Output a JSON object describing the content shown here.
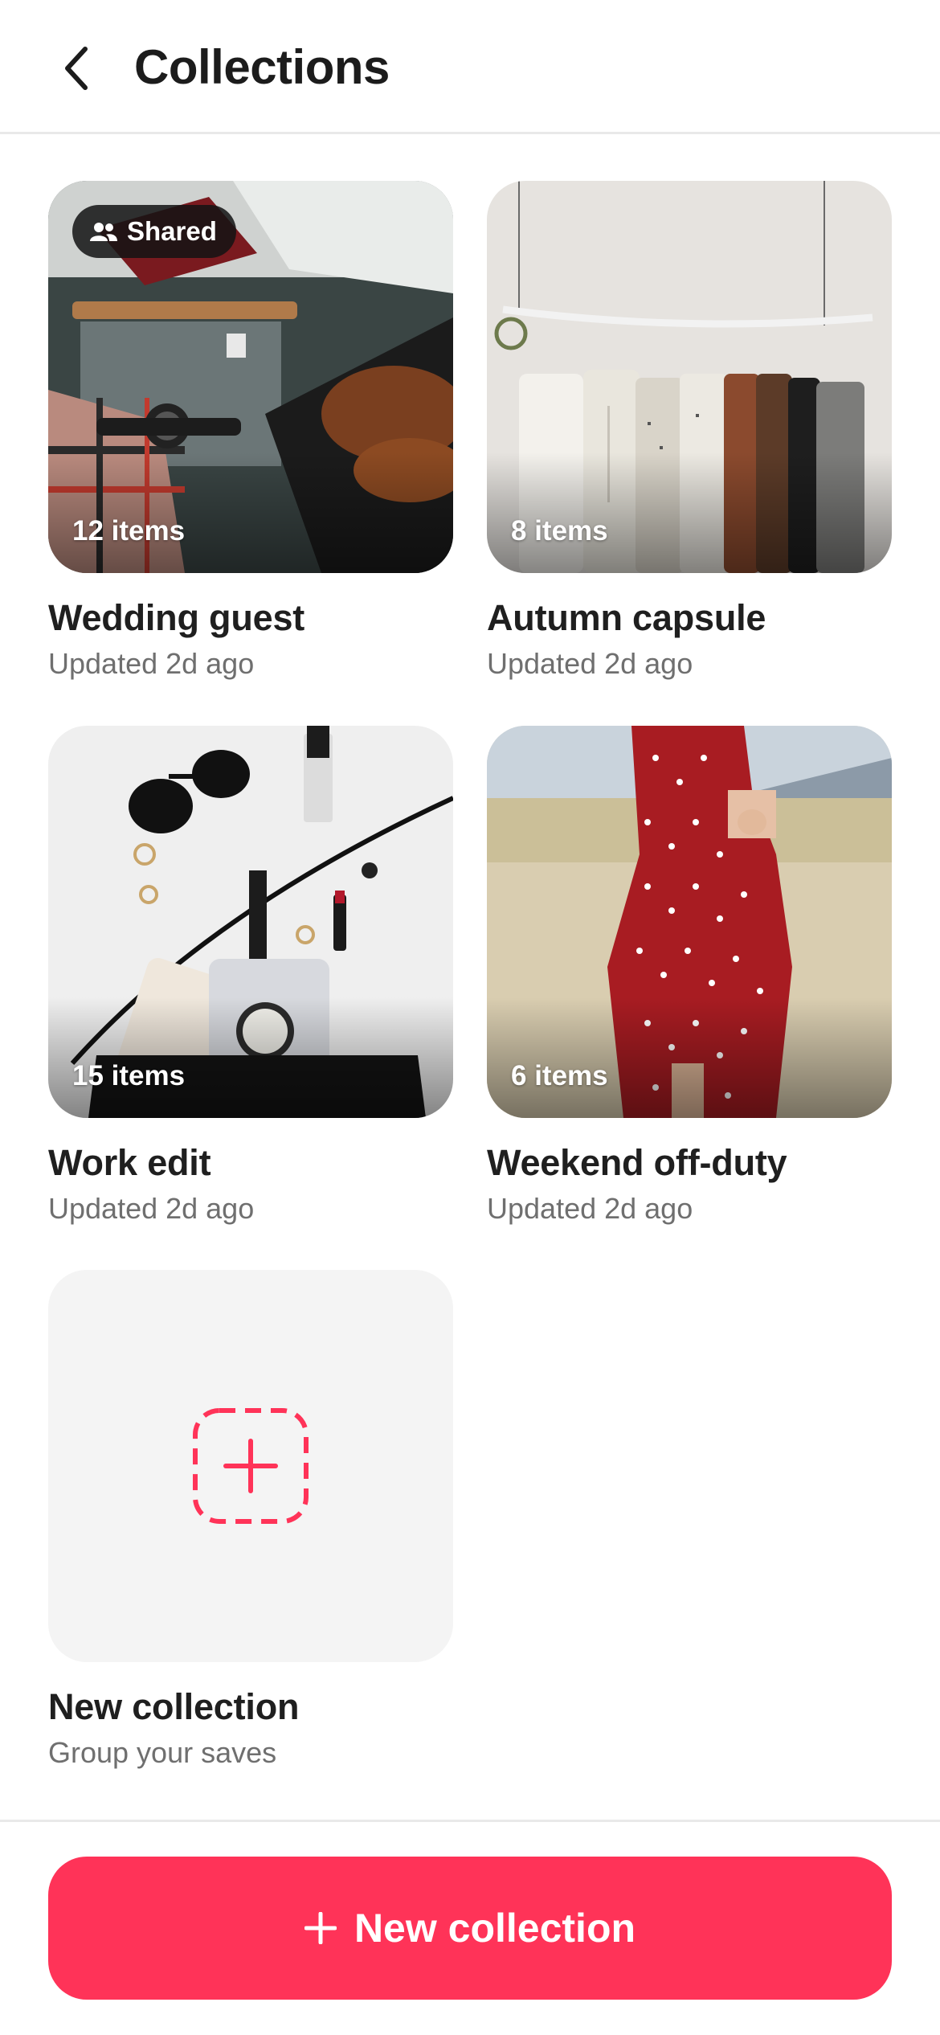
{
  "header": {
    "title": "Collections",
    "back_icon": "chevron-left-icon"
  },
  "collections": [
    {
      "title": "Wedding guest",
      "subtitle": "Updated 2d ago",
      "count": "12 items",
      "badge": "Shared",
      "badge_icon": "people-icon"
    },
    {
      "title": "Autumn capsule",
      "subtitle": "Updated 2d ago",
      "count": "8 items"
    },
    {
      "title": "Work edit",
      "subtitle": "Updated 2d ago",
      "count": "15 items"
    },
    {
      "title": "Weekend off-duty",
      "subtitle": "Updated 2d ago",
      "count": "6 items"
    }
  ],
  "new_card": {
    "title": "New collection",
    "subtitle": "Group your saves",
    "icon": "add-dashed-square-icon"
  },
  "cta": {
    "label": "New collection",
    "icon": "plus-icon"
  },
  "colors": {
    "accent": "#ff3358",
    "text": "#1f1f1f",
    "muted": "#6f6f6f",
    "placeholder_bg": "#f4f4f4"
  }
}
